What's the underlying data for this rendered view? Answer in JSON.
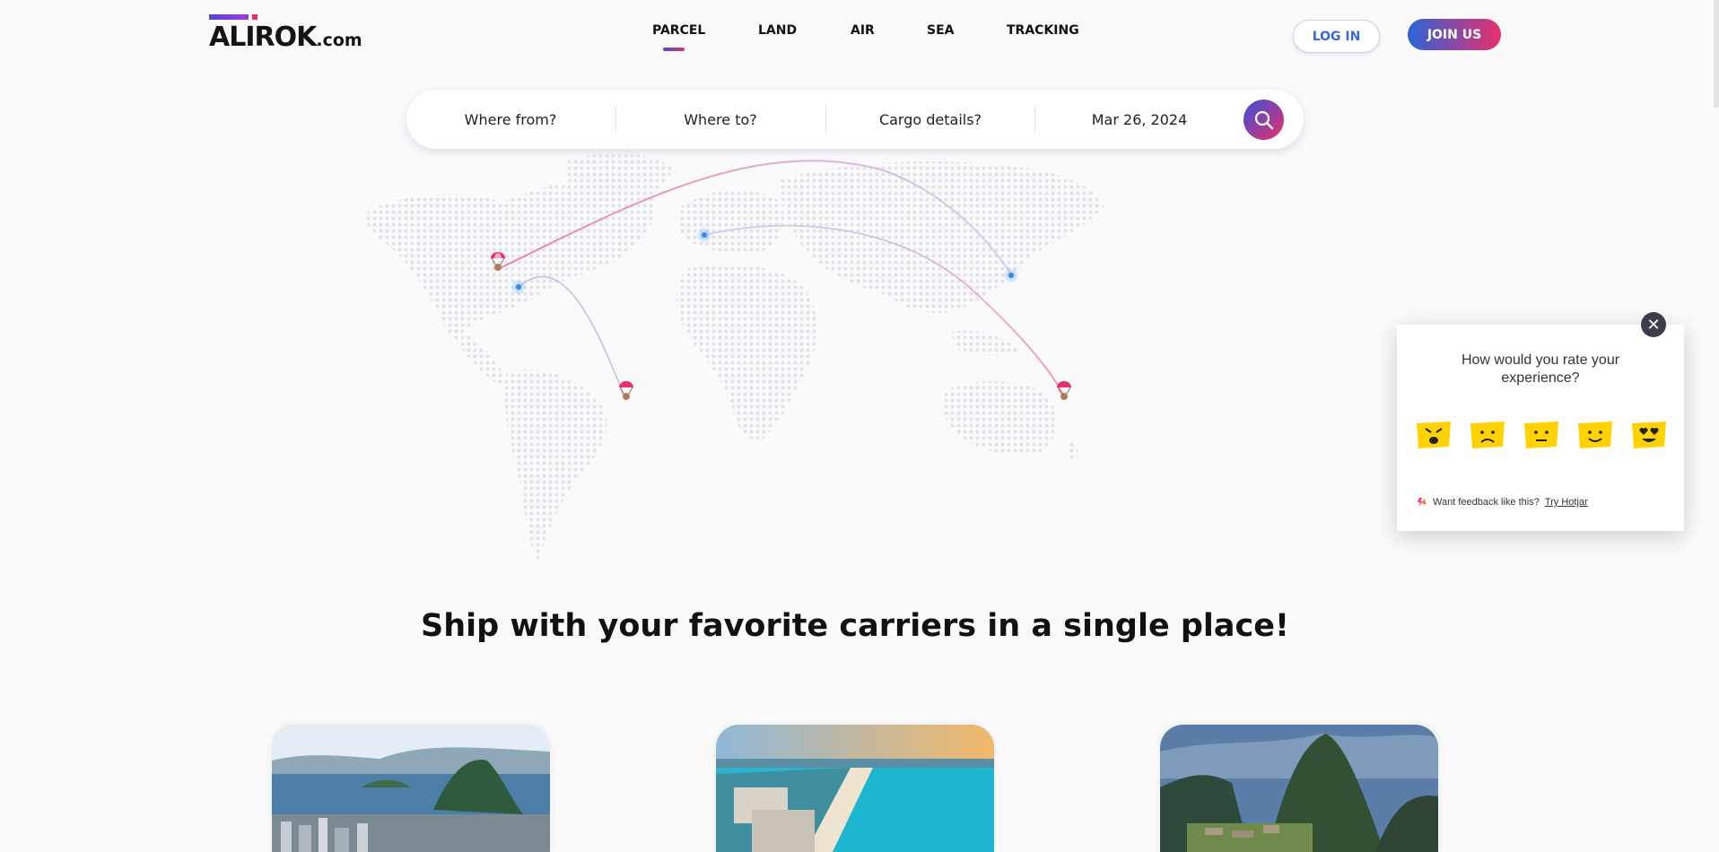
{
  "header": {
    "logo_text": "ALIROK",
    "logo_domain": ".com",
    "nav": [
      {
        "label": "PARCEL",
        "active": true
      },
      {
        "label": "LAND",
        "active": false
      },
      {
        "label": "AIR",
        "active": false
      },
      {
        "label": "SEA",
        "active": false
      },
      {
        "label": "TRACKING",
        "active": false
      }
    ],
    "login_label": "LOG IN",
    "join_label": "JOIN US"
  },
  "search": {
    "from_placeholder": "Where from?",
    "to_placeholder": "Where to?",
    "cargo_placeholder": "Cargo details?",
    "date_value": "Mar 26, 2024",
    "search_icon": "search-icon"
  },
  "map": {
    "icons": [
      "parachute-parcel-icon",
      "location-pin-icon"
    ]
  },
  "headline": "Ship with your favorite carriers in a single place!",
  "cards": [
    {
      "name": "rio-de-janeiro"
    },
    {
      "name": "cancun-beach"
    },
    {
      "name": "machu-picchu"
    }
  ],
  "feedback": {
    "question": "How would you rate your experience?",
    "ratings": [
      "very-bad",
      "bad",
      "neutral",
      "good",
      "love"
    ],
    "footer_text": "Want feedback like this?",
    "footer_link": "Try Hotjar",
    "close_icon": "close-icon"
  },
  "colors": {
    "accent_blue": "#2b64d8",
    "accent_pink": "#e8306e",
    "face_yellow": "#ffd200"
  }
}
